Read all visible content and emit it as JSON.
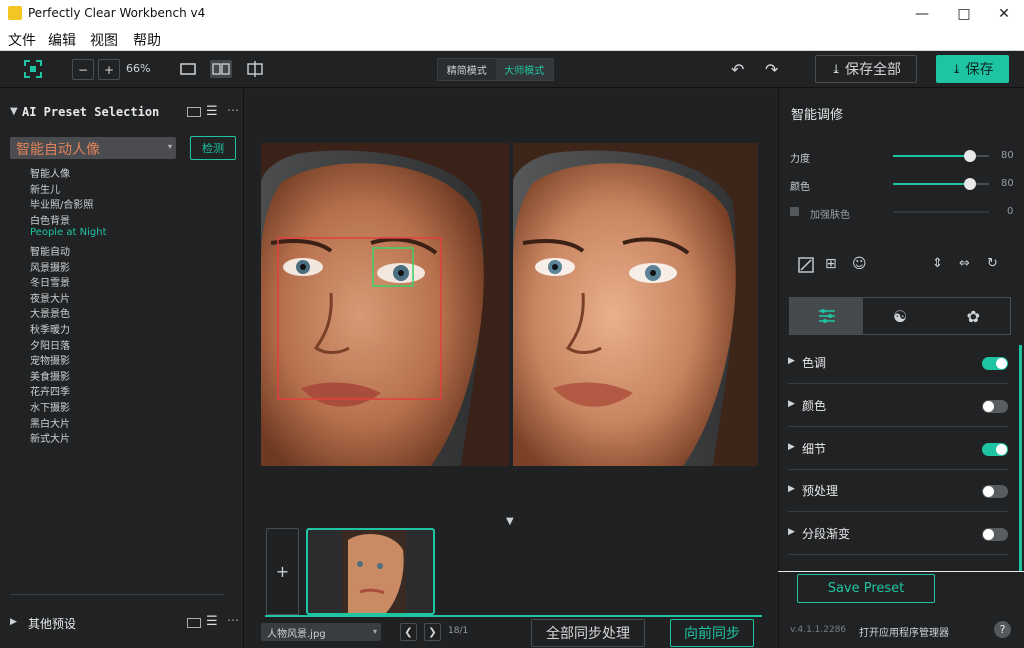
{
  "window": {
    "title": "Perfectly Clear Workbench v4"
  },
  "menu": [
    "文件",
    "编辑",
    "视图",
    "帮助"
  ],
  "toolbar": {
    "zoom": "66%",
    "mode_simple": "精简模式",
    "mode_master": "大师模式",
    "save_all": "保存全部",
    "save": "保存"
  },
  "left": {
    "header": "AI Preset Selection",
    "preset_select": "智能自动人像",
    "detect_btn": "检测",
    "presets": [
      "智能人像",
      "新生儿",
      "毕业照/合影照",
      "白色背景",
      "People at Night",
      "智能自动",
      "风景摄影",
      "冬日雪景",
      "夜景大片",
      "大景景色",
      "秋季暖力",
      "夕阳日落",
      "宠物摄影",
      "美食摄影",
      "花卉四季",
      "水下摄影",
      "黑白大片",
      "新式大片"
    ],
    "active_preset_index": 4,
    "other_presets": "其他预设"
  },
  "center": {
    "file_select": "人物风景.jpg",
    "page_counter": "18/1",
    "sync_all": "全部同步处理",
    "sync_forward": "向前同步"
  },
  "right": {
    "title": "智能调修",
    "sliders": [
      {
        "label": "力度",
        "value": "80",
        "fraction": 0.8
      },
      {
        "label": "颜色",
        "value": "80",
        "fraction": 0.8
      }
    ],
    "skin_label": "加强肤色",
    "skin_value": "0",
    "sections": [
      {
        "label": "色调",
        "on": true
      },
      {
        "label": "颜色",
        "on": false
      },
      {
        "label": "细节",
        "on": true
      },
      {
        "label": "预处理",
        "on": false
      },
      {
        "label": "分段渐变",
        "on": false
      }
    ],
    "save_preset": "Save Preset",
    "version": "v.4.1.1.2286",
    "open_manager": "打开应用程序管理器",
    "help": "?"
  },
  "colors": {
    "accent": "#1fc4a2",
    "panel": "#202224",
    "face_box": "#e0403c",
    "eye_box": "#3ad16a"
  }
}
